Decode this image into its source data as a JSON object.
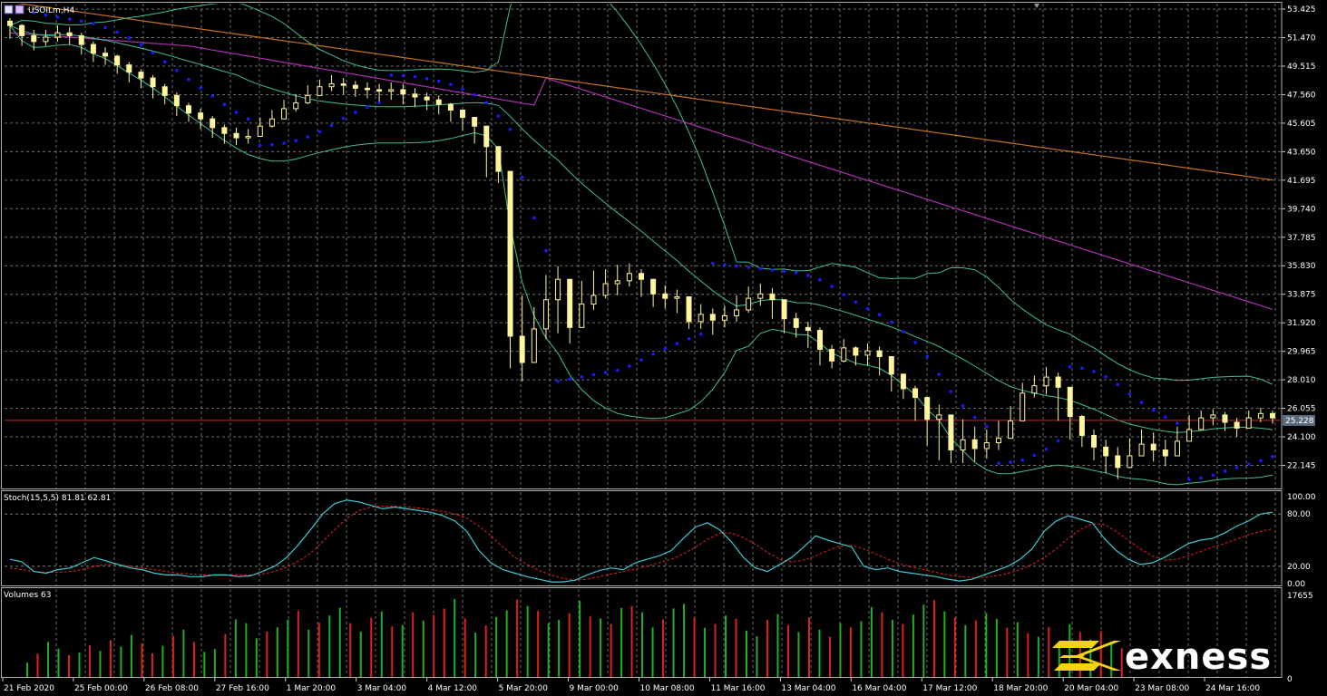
{
  "header": {
    "symbol_timeframe": "USOILm,H4",
    "stoch_label": "Stoch(15,5,5) 81.81 62.81",
    "volumes_label": "Volumes 63"
  },
  "logo": {
    "brand": "exness"
  },
  "colors": {
    "background": "#000000",
    "grid": "#9a9a9a",
    "candle": "#fff59a",
    "psar": "#1a1aff",
    "bollinger": "#3fbf8f",
    "ma_magenta": "#b030b0",
    "ma_orange": "#c8701c",
    "price_line": "#d02020",
    "stoch_main": "#3fc8d0",
    "stoch_signal": "#e02020",
    "vol_up": "#20b020",
    "vol_down": "#e02020",
    "logo_yellow": "#f5d40f"
  },
  "chart_data": [
    {
      "type": "candlestick",
      "panel": "price",
      "ylim": [
        20.5,
        53.8
      ],
      "current_price": 25.228,
      "current_price_label": "25.228",
      "y_ticks": [
        "53.425",
        "51.470",
        "49.515",
        "47.560",
        "45.605",
        "43.650",
        "41.695",
        "39.740",
        "37.785",
        "35.830",
        "33.875",
        "31.920",
        "29.965",
        "28.010",
        "26.055",
        "24.100",
        "22.145"
      ],
      "x_ticks": [
        "21 Feb 2020",
        "25 Feb 00:00",
        "26 Feb 08:00",
        "27 Feb 16:00",
        "1 Mar 20:00",
        "3 Mar 04:00",
        "4 Mar 12:00",
        "5 Mar 20:00",
        "9 Mar 00:00",
        "10 Mar 08:00",
        "11 Mar 16:00",
        "13 Mar 04:00",
        "16 Mar 04:00",
        "17 Mar 12:00",
        "18 Mar 20:00",
        "20 Mar 04:00",
        "23 Mar 08:00",
        "24 Mar 16:00"
      ],
      "close": [
        52.3,
        51.6,
        51.2,
        51.5,
        51.8,
        51.6,
        51.0,
        50.4,
        50.2,
        49.6,
        49.1,
        48.7,
        48.1,
        47.5,
        46.8,
        46.3,
        45.9,
        45.3,
        44.9,
        44.6,
        44.7,
        45.4,
        45.9,
        46.6,
        47.0,
        47.5,
        48.1,
        48.3,
        48.2,
        48.0,
        47.9,
        47.8,
        47.9,
        47.6,
        47.4,
        47.2,
        46.9,
        46.5,
        46.0,
        45.4,
        44.0,
        42.3,
        31.0,
        29.2,
        31.5,
        33.5,
        34.9,
        31.6,
        33.2,
        33.8,
        34.6,
        34.8,
        35.3,
        34.9,
        33.9,
        33.6,
        33.7,
        32.0,
        32.5,
        32.1,
        32.4,
        32.8,
        33.6,
        33.9,
        33.5,
        32.2,
        31.6,
        31.4,
        30.1,
        29.3,
        30.2,
        29.7,
        30.0,
        29.6,
        28.4,
        27.4,
        26.8,
        25.3,
        25.6,
        23.2,
        23.9,
        23.3,
        23.7,
        24.0,
        25.2,
        27.1,
        27.6,
        28.2,
        27.5,
        25.5,
        24.2,
        23.4,
        22.8,
        22.0,
        22.8,
        23.6,
        23.2,
        22.8,
        23.8,
        24.6,
        25.4,
        25.6,
        25.1,
        24.7,
        25.4,
        25.7,
        25.4
      ],
      "high": [
        52.8,
        52.4,
        52.0,
        52.0,
        52.3,
        52.2,
        51.8,
        51.2,
        50.8,
        50.3,
        49.8,
        49.3,
        48.9,
        48.3,
        47.7,
        47.0,
        46.6,
        46.1,
        45.5,
        45.3,
        45.2,
        46.0,
        46.5,
        47.2,
        47.6,
        48.2,
        48.6,
        48.9,
        48.7,
        48.5,
        48.4,
        48.3,
        48.4,
        48.3,
        48.0,
        47.7,
        47.5,
        47.0,
        46.5,
        46.0,
        45.2,
        43.5,
        35.0,
        33.8,
        33.0,
        35.2,
        35.8,
        34.5,
        34.8,
        35.5,
        35.6,
        35.9,
        36.0,
        35.6,
        34.7,
        34.5,
        34.2,
        33.5,
        33.2,
        32.9,
        33.1,
        33.8,
        34.4,
        34.6,
        34.3,
        33.4,
        32.6,
        32.0,
        31.6,
        30.4,
        30.8,
        30.3,
        30.5,
        30.3,
        29.6,
        28.2,
        27.6,
        26.5,
        26.3,
        25.3,
        25.3,
        24.8,
        24.6,
        25.2,
        26.2,
        27.8,
        28.3,
        28.9,
        28.5,
        27.2,
        25.6,
        24.6,
        23.9,
        23.4,
        24.0,
        24.6,
        24.4,
        23.9,
        24.8,
        25.6,
        25.9,
        26.0,
        25.8,
        25.4,
        25.9,
        26.1,
        25.9
      ],
      "low": [
        51.4,
        50.9,
        50.6,
        50.9,
        51.2,
        51.0,
        50.3,
        49.8,
        49.6,
        49.0,
        48.4,
        48.0,
        47.3,
        46.9,
        46.1,
        45.7,
        45.2,
        44.6,
        44.2,
        44.1,
        44.2,
        44.9,
        45.3,
        46.0,
        46.4,
        46.9,
        47.6,
        47.8,
        47.6,
        47.4,
        47.3,
        47.1,
        47.2,
        46.9,
        46.7,
        46.5,
        46.2,
        45.7,
        45.1,
        44.2,
        41.9,
        41.5,
        28.8,
        27.9,
        29.5,
        30.8,
        31.2,
        30.5,
        31.9,
        32.8,
        33.6,
        33.8,
        34.4,
        33.7,
        33.0,
        32.9,
        32.6,
        31.5,
        31.5,
        31.1,
        31.6,
        32.0,
        32.6,
        33.1,
        32.2,
        31.2,
        30.9,
        30.2,
        29.0,
        28.8,
        29.2,
        29.0,
        29.0,
        28.3,
        27.2,
        26.7,
        25.2,
        23.5,
        22.5,
        22.3,
        22.3,
        22.4,
        22.6,
        23.2,
        24.5,
        26.2,
        26.8,
        27.0,
        25.2,
        23.9,
        23.4,
        22.5,
        21.6,
        21.2,
        22.0,
        22.9,
        22.4,
        22.1,
        23.1,
        24.0,
        24.8,
        24.9,
        24.5,
        24.1,
        24.8,
        25.1,
        25.0
      ]
    },
    {
      "type": "line",
      "panel": "stochastic",
      "ylim": [
        0,
        100
      ],
      "y_ticks": [
        "100.00",
        "80.00",
        "20.00",
        "0.00"
      ],
      "series": [
        {
          "name": "Stoch(15,5,5) 81.81",
          "role": "main",
          "values": [
            28,
            25,
            14,
            12,
            16,
            18,
            24,
            30,
            26,
            22,
            18,
            16,
            12,
            10,
            10,
            8,
            8,
            10,
            10,
            8,
            9,
            14,
            20,
            30,
            45,
            62,
            80,
            92,
            96,
            94,
            90,
            86,
            88,
            86,
            84,
            82,
            78,
            72,
            60,
            38,
            24,
            16,
            12,
            8,
            5,
            2,
            2,
            4,
            10,
            15,
            18,
            16,
            24,
            28,
            32,
            38,
            52,
            65,
            70,
            62,
            48,
            30,
            18,
            14,
            22,
            30,
            42,
            55,
            50,
            46,
            42,
            20,
            16,
            18,
            14,
            12,
            10,
            8,
            5,
            3,
            5,
            10,
            15,
            20,
            28,
            40,
            60,
            72,
            78,
            74,
            70,
            52,
            38,
            28,
            22,
            24,
            30,
            38,
            46,
            50,
            52,
            58,
            66,
            72,
            80,
            82
          ]
        },
        {
          "name": "62.81",
          "role": "signal",
          "values": [
            18,
            16,
            14,
            13,
            13,
            14,
            16,
            20,
            22,
            22,
            20,
            18,
            16,
            14,
            12,
            11,
            10,
            10,
            10,
            10,
            10,
            11,
            14,
            19,
            26,
            35,
            48,
            62,
            75,
            84,
            88,
            89,
            89,
            88,
            87,
            85,
            83,
            80,
            75,
            66,
            55,
            42,
            30,
            22,
            15,
            10,
            6,
            4,
            5,
            8,
            11,
            14,
            17,
            20,
            24,
            28,
            34,
            42,
            51,
            58,
            58,
            53,
            45,
            36,
            28,
            25,
            27,
            32,
            38,
            43,
            44,
            40,
            34,
            28,
            23,
            19,
            16,
            13,
            10,
            8,
            7,
            7,
            9,
            12,
            16,
            22,
            30,
            40,
            52,
            62,
            69,
            68,
            60,
            50,
            40,
            32,
            27,
            28,
            32,
            37,
            42,
            46,
            51,
            56,
            60,
            63
          ]
        }
      ]
    },
    {
      "type": "bar",
      "panel": "volumes",
      "ylim": [
        0,
        17655
      ],
      "y_ticks": [
        "17655",
        "0"
      ],
      "series": [
        {
          "name": "Volumes 63",
          "values": [
            3200,
            5100,
            7600,
            6200,
            4800,
            5400,
            6900,
            5700,
            8000,
            6600,
            9100,
            7300,
            5200,
            6800,
            8900,
            10200,
            7600,
            5500,
            6100,
            9300,
            12400,
            11600,
            8400,
            9800,
            10700,
            12300,
            14200,
            10200,
            11700,
            13200,
            14900,
            11600,
            9800,
            12700,
            14100,
            10900,
            11200,
            13900,
            12100,
            13300,
            14700,
            16700,
            12600,
            9600,
            11100,
            12900,
            14300,
            16600,
            15200,
            14200,
            11600,
            12300,
            13700,
            16300,
            13000,
            12600,
            11400,
            14800,
            15200,
            13900,
            10700,
            12400,
            14700,
            15700,
            12800,
            10600,
            11400,
            13200,
            12500,
            10000,
            8800,
            12300,
            13500,
            11200,
            9700,
            12800,
            10200,
            8700,
            11600,
            10700,
            12000,
            15000,
            13900,
            12300,
            11400,
            13400,
            15500,
            16500,
            14100,
            12800,
            11200,
            12200,
            13700,
            12500,
            10600,
            11800,
            9500,
            8700,
            10800,
            7600,
            11400,
            9700,
            8100,
            9900,
            7400,
            6300
          ]
        },
        {
          "name": "direction",
          "values": [
            1,
            0,
            1,
            1,
            0,
            1,
            0,
            1,
            0,
            1,
            1,
            0,
            0,
            1,
            0,
            1,
            0,
            1,
            1,
            0,
            1,
            1,
            1,
            0,
            1,
            1,
            0,
            1,
            0,
            1,
            1,
            0,
            1,
            0,
            1,
            0,
            1,
            0,
            1,
            0,
            0,
            1,
            0,
            1,
            0,
            1,
            1,
            0,
            1,
            0,
            1,
            1,
            0,
            1,
            0,
            1,
            0,
            1,
            0,
            1,
            1,
            0,
            1,
            1,
            0,
            1,
            0,
            1,
            0,
            1,
            1,
            0,
            1,
            0,
            1,
            0,
            1,
            0,
            1,
            0,
            1,
            1,
            0,
            1,
            0,
            1,
            1,
            0,
            1,
            0,
            1,
            0,
            1,
            1,
            0,
            1,
            0,
            1,
            0,
            1,
            1,
            0,
            1,
            0,
            1,
            0
          ]
        }
      ]
    }
  ]
}
